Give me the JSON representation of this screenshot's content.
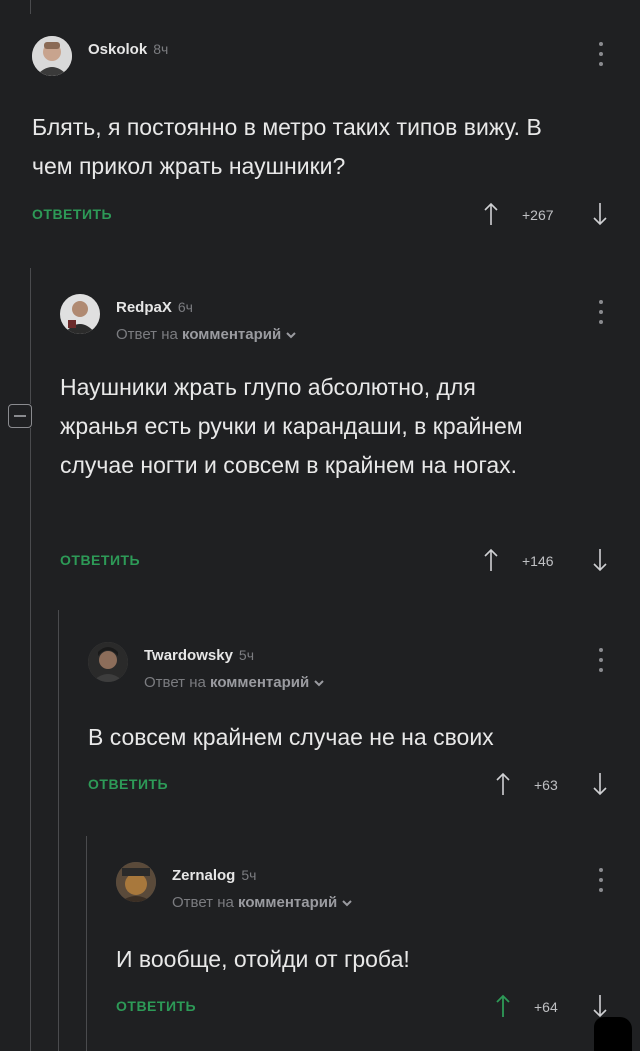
{
  "colors": {
    "background": "#1f2022",
    "accent_green": "#2d9a57",
    "text": "#e8e8e8",
    "muted": "#7b7c80"
  },
  "comments": [
    {
      "author": "Oskolok",
      "time": "8ч",
      "reply_to": null,
      "text": "Блять, я постоянно в метро таких типов вижу. В чем прикол жрать наушники?",
      "reply_label": "ОТВЕТИТЬ",
      "score": "+267"
    },
    {
      "author": "RedpaX",
      "time": "6ч",
      "reply_to_prefix": "Ответ на",
      "reply_to_link": "комментарий",
      "text": "Наушники жрать глупо абсолютно, для жранья есть ручки и карандаши, в крайнем случае ногти и совсем в крайнем на ногах.",
      "reply_label": "ОТВЕТИТЬ",
      "score": "+146"
    },
    {
      "author": "Twardowsky",
      "time": "5ч",
      "reply_to_prefix": "Ответ на",
      "reply_to_link": "комментарий",
      "text": "В совсем крайнем случае не на своих",
      "reply_label": "ОТВЕТИТЬ",
      "score": "+63"
    },
    {
      "author": "Zernalog",
      "time": "5ч",
      "reply_to_prefix": "Ответ на",
      "reply_to_link": "комментарий",
      "text": "И вообще, отойди от гроба!",
      "reply_label": "ОТВЕТИТЬ",
      "score": "+64"
    }
  ],
  "icons": {
    "upvote": "arrow-up-icon",
    "downvote": "arrow-down-icon",
    "menu": "more-vertical-icon",
    "collapse": "collapse-minus-icon",
    "expand_reply": "chevron-down-icon"
  }
}
